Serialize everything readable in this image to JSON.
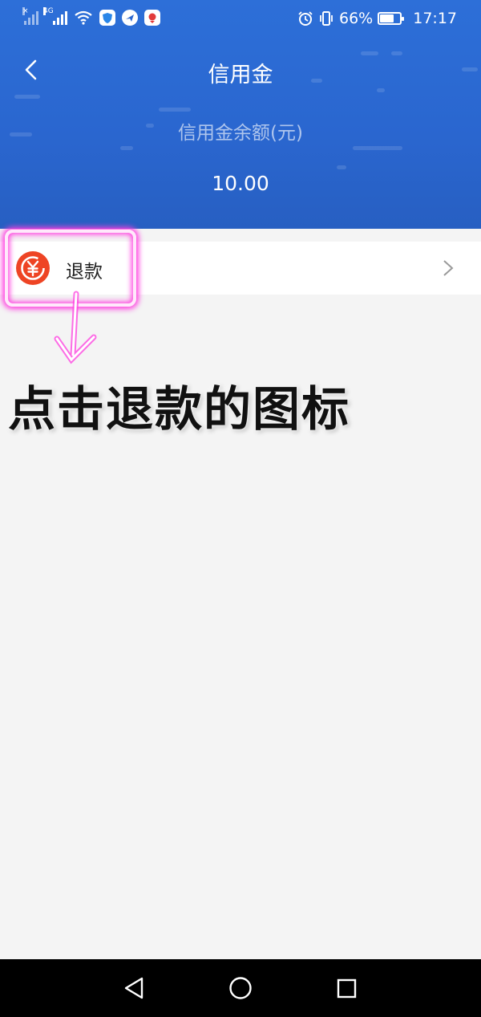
{
  "status_bar": {
    "network_label": "4G",
    "battery_percent": "66%",
    "battery_level": 0.66,
    "time": "17:17",
    "icons": [
      "no-signal-icon",
      "signal-4g-icon",
      "wifi-icon",
      "shield-app-icon",
      "bird-app-icon",
      "map-app-icon",
      "alarm-icon",
      "vibrate-icon",
      "battery-icon"
    ]
  },
  "header": {
    "back_icon": "chevron-left-icon",
    "title": "信用金",
    "balance_label": "信用金余额(元)",
    "balance_value": "10.00"
  },
  "list": {
    "items": [
      {
        "label": "退款",
        "icon": "yuan-refund-icon",
        "icon_color": "#ee4424",
        "chevron": "chevron-right-icon"
      }
    ]
  },
  "annotation": {
    "text": "点击退款的图标",
    "highlight_color": "#ff3fe0"
  },
  "colors": {
    "header_blue": "#2a66cf",
    "page_bg": "#f4f4f4",
    "nav_bar": "#000000"
  },
  "system_nav": {
    "icons": [
      "back-triangle-icon",
      "home-circle-icon",
      "recents-square-icon"
    ]
  }
}
